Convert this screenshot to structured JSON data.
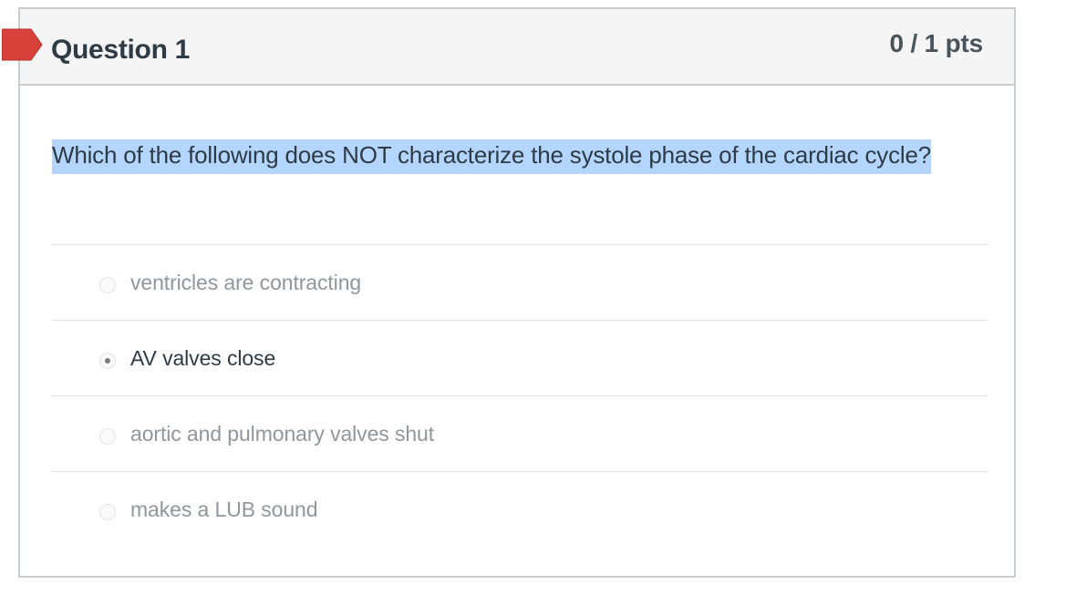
{
  "question": {
    "title": "Question 1",
    "points": "0 / 1 pts",
    "text": "Which of the following does NOT characterize the systole phase of the cardiac cycle?"
  },
  "answers": [
    {
      "label": "ventricles are contracting",
      "selected": false
    },
    {
      "label": "AV valves close",
      "selected": true
    },
    {
      "label": "aortic and pulmonary valves shut",
      "selected": false
    },
    {
      "label": "makes a LUB sound",
      "selected": false
    }
  ],
  "colors": {
    "flag": "#d9413b",
    "highlight": "#b4d5fe",
    "header_bg": "#f5f5f5",
    "border": "#c7cdd1",
    "text_dark": "#2d3b45",
    "text_muted": "#8f979c"
  },
  "icons": {
    "flag": "flag-icon",
    "radio": "radio-icon"
  }
}
